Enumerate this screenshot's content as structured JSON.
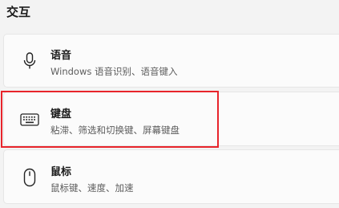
{
  "section": {
    "title": "交互"
  },
  "items": [
    {
      "title": "语音",
      "description": "Windows 语音识别、语音键入",
      "icon": "microphone-icon"
    },
    {
      "title": "键盘",
      "description": "粘滞、筛选和切换键、屏幕键盘",
      "icon": "keyboard-icon"
    },
    {
      "title": "鼠标",
      "description": "鼠标键、速度、加速",
      "icon": "mouse-icon"
    }
  ],
  "colors": {
    "background": "#f3f3f3",
    "card": "#fbfbfb",
    "highlight": "#e8242b"
  }
}
